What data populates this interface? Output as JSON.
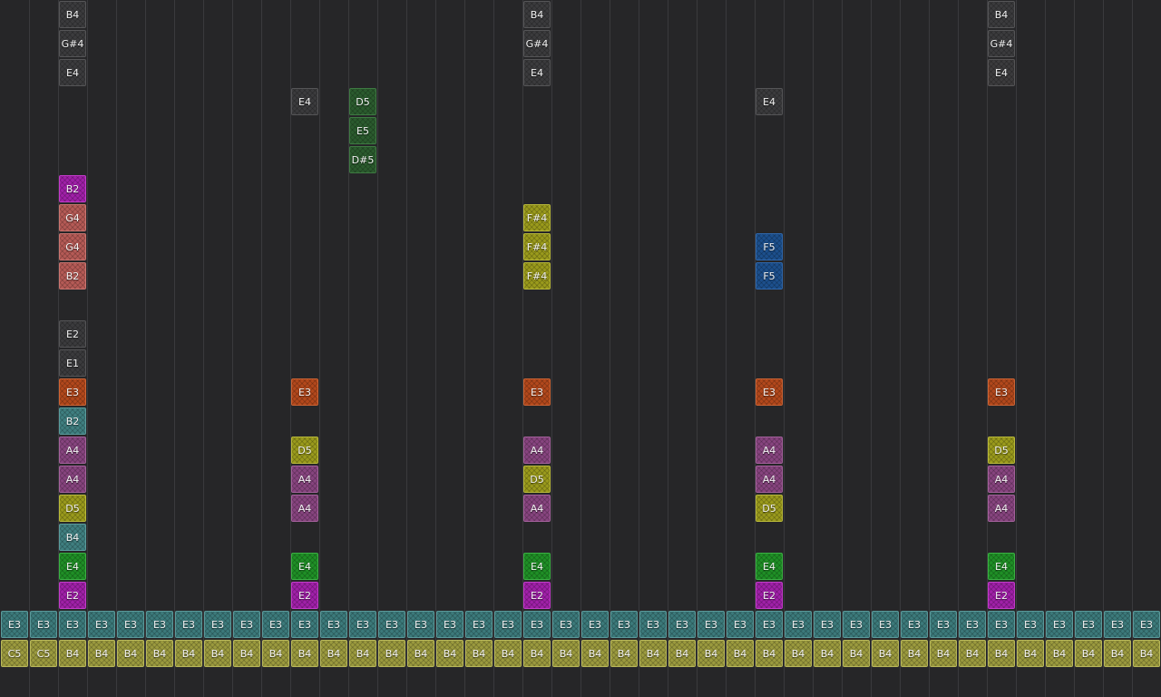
{
  "palette": {
    "gray": {
      "bg": "#3b3b3d",
      "border": "#555557"
    },
    "green": {
      "bg": "#2b5b2e",
      "border": "#3e7a42"
    },
    "magenta": {
      "bg": "#a020a8",
      "border": "#c23bc9"
    },
    "salmon": {
      "bg": "#b55a56",
      "border": "#c97570"
    },
    "olive": {
      "bg": "#9a9a1c",
      "border": "#b9b93a"
    },
    "blue": {
      "bg": "#1c4f8c",
      "border": "#2f68ad"
    },
    "orange": {
      "bg": "#b2481c",
      "border": "#cd6434"
    },
    "teal": {
      "bg": "#3f7f80",
      "border": "#5a9b9c"
    },
    "purple": {
      "bg": "#87447f",
      "border": "#a3619b"
    },
    "bright_green": {
      "bg": "#1f8f26",
      "border": "#3bb043"
    },
    "track_teal": {
      "bg": "#3c7a7b",
      "border": "#5a9899"
    },
    "track_olive": {
      "bg": "#9b9a3e",
      "border": "#b8b75a"
    }
  },
  "notes": [
    {
      "col": 2,
      "row": 0,
      "label": "B4",
      "color": "gray"
    },
    {
      "col": 2,
      "row": 1,
      "label": "G#4",
      "color": "gray"
    },
    {
      "col": 2,
      "row": 2,
      "label": "E4",
      "color": "gray"
    },
    {
      "col": 2,
      "row": 6,
      "label": "B2",
      "color": "magenta"
    },
    {
      "col": 2,
      "row": 7,
      "label": "G4",
      "color": "salmon"
    },
    {
      "col": 2,
      "row": 8,
      "label": "G4",
      "color": "salmon"
    },
    {
      "col": 2,
      "row": 9,
      "label": "B2",
      "color": "salmon"
    },
    {
      "col": 2,
      "row": 11,
      "label": "E2",
      "color": "gray"
    },
    {
      "col": 2,
      "row": 12,
      "label": "E1",
      "color": "gray"
    },
    {
      "col": 2,
      "row": 13,
      "label": "E3",
      "color": "orange"
    },
    {
      "col": 2,
      "row": 14,
      "label": "B2",
      "color": "teal"
    },
    {
      "col": 2,
      "row": 15,
      "label": "A4",
      "color": "purple"
    },
    {
      "col": 2,
      "row": 16,
      "label": "A4",
      "color": "purple"
    },
    {
      "col": 2,
      "row": 17,
      "label": "D5",
      "color": "olive"
    },
    {
      "col": 2,
      "row": 18,
      "label": "B4",
      "color": "teal"
    },
    {
      "col": 2,
      "row": 19,
      "label": "E4",
      "color": "bright_green"
    },
    {
      "col": 2,
      "row": 20,
      "label": "E2",
      "color": "magenta"
    },
    {
      "col": 10,
      "row": 3,
      "label": "E4",
      "color": "gray"
    },
    {
      "col": 10,
      "row": 13,
      "label": "E3",
      "color": "orange"
    },
    {
      "col": 10,
      "row": 15,
      "label": "D5",
      "color": "olive"
    },
    {
      "col": 10,
      "row": 16,
      "label": "A4",
      "color": "purple"
    },
    {
      "col": 10,
      "row": 17,
      "label": "A4",
      "color": "purple"
    },
    {
      "col": 10,
      "row": 19,
      "label": "E4",
      "color": "bright_green"
    },
    {
      "col": 10,
      "row": 20,
      "label": "E2",
      "color": "magenta"
    },
    {
      "col": 12,
      "row": 3,
      "label": "D5",
      "color": "green"
    },
    {
      "col": 12,
      "row": 4,
      "label": "E5",
      "color": "green"
    },
    {
      "col": 12,
      "row": 5,
      "label": "D#5",
      "color": "green"
    },
    {
      "col": 18,
      "row": 0,
      "label": "B4",
      "color": "gray"
    },
    {
      "col": 18,
      "row": 1,
      "label": "G#4",
      "color": "gray"
    },
    {
      "col": 18,
      "row": 2,
      "label": "E4",
      "color": "gray"
    },
    {
      "col": 18,
      "row": 7,
      "label": "F#4",
      "color": "olive"
    },
    {
      "col": 18,
      "row": 8,
      "label": "F#4",
      "color": "olive"
    },
    {
      "col": 18,
      "row": 9,
      "label": "F#4",
      "color": "olive"
    },
    {
      "col": 18,
      "row": 13,
      "label": "E3",
      "color": "orange"
    },
    {
      "col": 18,
      "row": 15,
      "label": "A4",
      "color": "purple"
    },
    {
      "col": 18,
      "row": 16,
      "label": "D5",
      "color": "olive"
    },
    {
      "col": 18,
      "row": 17,
      "label": "A4",
      "color": "purple"
    },
    {
      "col": 18,
      "row": 19,
      "label": "E4",
      "color": "bright_green"
    },
    {
      "col": 18,
      "row": 20,
      "label": "E2",
      "color": "magenta"
    },
    {
      "col": 26,
      "row": 3,
      "label": "E4",
      "color": "gray"
    },
    {
      "col": 26,
      "row": 8,
      "label": "F5",
      "color": "blue"
    },
    {
      "col": 26,
      "row": 9,
      "label": "F5",
      "color": "blue"
    },
    {
      "col": 26,
      "row": 13,
      "label": "E3",
      "color": "orange"
    },
    {
      "col": 26,
      "row": 15,
      "label": "A4",
      "color": "purple"
    },
    {
      "col": 26,
      "row": 16,
      "label": "A4",
      "color": "purple"
    },
    {
      "col": 26,
      "row": 17,
      "label": "D5",
      "color": "olive"
    },
    {
      "col": 26,
      "row": 19,
      "label": "E4",
      "color": "bright_green"
    },
    {
      "col": 26,
      "row": 20,
      "label": "E2",
      "color": "magenta"
    },
    {
      "col": 34,
      "row": 0,
      "label": "B4",
      "color": "gray"
    },
    {
      "col": 34,
      "row": 1,
      "label": "G#4",
      "color": "gray"
    },
    {
      "col": 34,
      "row": 2,
      "label": "E4",
      "color": "gray"
    },
    {
      "col": 34,
      "row": 13,
      "label": "E3",
      "color": "orange"
    },
    {
      "col": 34,
      "row": 15,
      "label": "D5",
      "color": "olive"
    },
    {
      "col": 34,
      "row": 16,
      "label": "A4",
      "color": "purple"
    },
    {
      "col": 34,
      "row": 17,
      "label": "A4",
      "color": "purple"
    },
    {
      "col": 34,
      "row": 19,
      "label": "E4",
      "color": "bright_green"
    },
    {
      "col": 34,
      "row": 20,
      "label": "E2",
      "color": "magenta"
    }
  ],
  "track_rows": [
    {
      "row": 21,
      "color": "track_teal",
      "labels": [
        "E3",
        "E3",
        "E3",
        "E3",
        "E3",
        "E3",
        "E3",
        "E3",
        "E3",
        "E3",
        "E3",
        "E3",
        "E3",
        "E3",
        "E3",
        "E3",
        "E3",
        "E3",
        "E3",
        "E3",
        "E3",
        "E3",
        "E3",
        "E3",
        "E3",
        "E3",
        "E3",
        "E3",
        "E3",
        "E3",
        "E3",
        "E3",
        "E3",
        "E3",
        "E3",
        "E3",
        "E3",
        "E3",
        "E3",
        "E3"
      ]
    },
    {
      "row": 22,
      "color": "track_olive",
      "labels": [
        "C5",
        "C5",
        "B4",
        "B4",
        "B4",
        "B4",
        "B4",
        "B4",
        "B4",
        "B4",
        "B4",
        "B4",
        "B4",
        "B4",
        "B4",
        "B4",
        "B4",
        "B4",
        "B4",
        "B4",
        "B4",
        "B4",
        "B4",
        "B4",
        "B4",
        "B4",
        "B4",
        "B4",
        "B4",
        "B4",
        "B4",
        "B4",
        "B4",
        "B4",
        "B4",
        "B4",
        "B4",
        "B4",
        "B4",
        "B4"
      ]
    }
  ]
}
